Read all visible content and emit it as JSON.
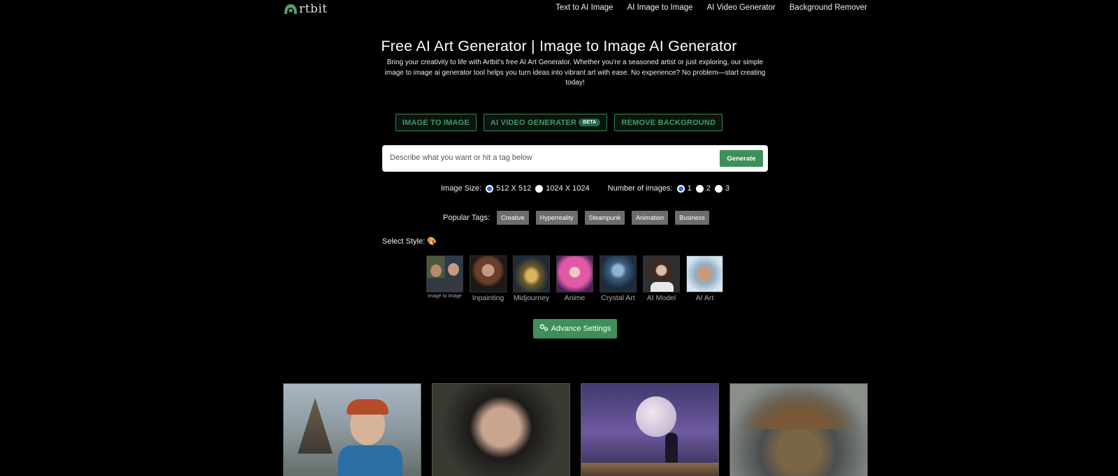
{
  "header": {
    "logo_text": "rtbit",
    "logo_icon": "artbit-logo-icon",
    "nav": [
      "Text to AI Image",
      "AI Image to Image",
      "AI Video Generator",
      "Background Remover"
    ]
  },
  "hero": {
    "title": "Free AI Art Generator | Image to Image AI Generator",
    "description": "Bring your creativity to life with Artbit's free AI Art Generator. Whether you're a seasoned artist or just exploring, our simple image to image ai generator tool helps you turn ideas into vibrant art with ease. No experience? No problem—start creating today!"
  },
  "modes": {
    "image_to_image": "IMAGE TO IMAGE",
    "video": "AI VIDEO GENERATER",
    "beta": "BETA",
    "remove_bg": "REMOVE BACKGROUND"
  },
  "prompt": {
    "placeholder": "Describe what you want or hit a tag below",
    "generate_label": "Generate"
  },
  "options": {
    "size_label": "Image Size:",
    "size_options": [
      "512 X 512",
      "1024 X 1024"
    ],
    "size_selected": "512 X 512",
    "count_label": "Number of images:",
    "count_options": [
      "1",
      "2",
      "3"
    ],
    "count_selected": "1"
  },
  "tags": {
    "label": "Popular Tags:",
    "items": [
      "Creative",
      "Hyperreality",
      "Steampunk",
      "Animation",
      "Business"
    ]
  },
  "style_select": {
    "label": "Select Style:",
    "icon": "palette-icon",
    "items": [
      "Image to Image",
      "Inpainting",
      "Midjourney",
      "Anime",
      "Crystal Art",
      "AI Model",
      "AI Art"
    ]
  },
  "advance": {
    "label": "Advance Settings",
    "icon": "gears-icon"
  },
  "colors": {
    "accent": "#3e8f59",
    "accent_text": "#3c9e5e",
    "background": "#000000",
    "radio": "#2e67d4"
  }
}
